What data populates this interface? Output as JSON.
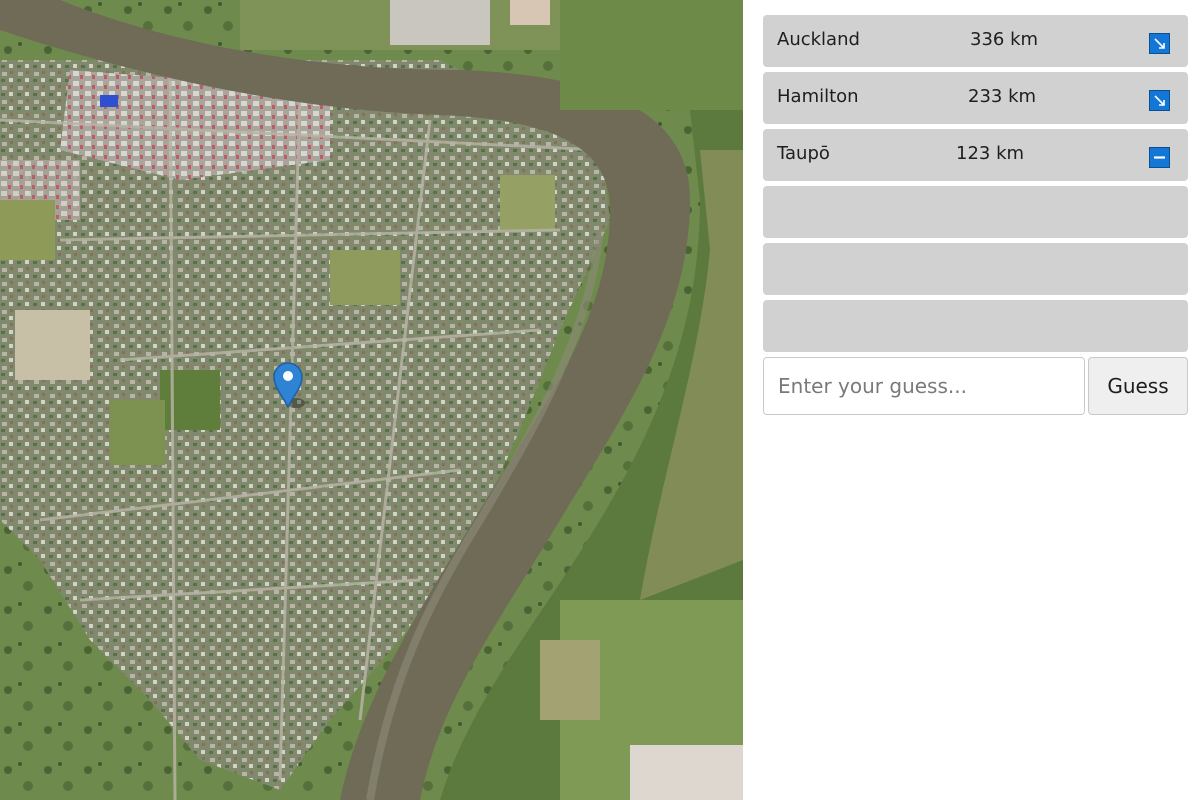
{
  "guesses": [
    {
      "name": "Auckland",
      "distance": "336 km",
      "direction_icon": "arrow-southeast-icon"
    },
    {
      "name": "Hamilton",
      "distance": "233 km",
      "direction_icon": "arrow-southeast-icon"
    },
    {
      "name": "Taupō",
      "distance": "123 km",
      "direction_icon": "arrow-east-icon"
    }
  ],
  "empty_slots": 3,
  "input": {
    "value": "",
    "placeholder": "Enter your guess..."
  },
  "guess_button": {
    "label": "Guess"
  },
  "map": {
    "marker_icon": "map-pin-icon"
  },
  "colors": {
    "row_bg": "#d1d1d1",
    "direction_icon": "#1277d6",
    "pin": "#2f83d4"
  }
}
